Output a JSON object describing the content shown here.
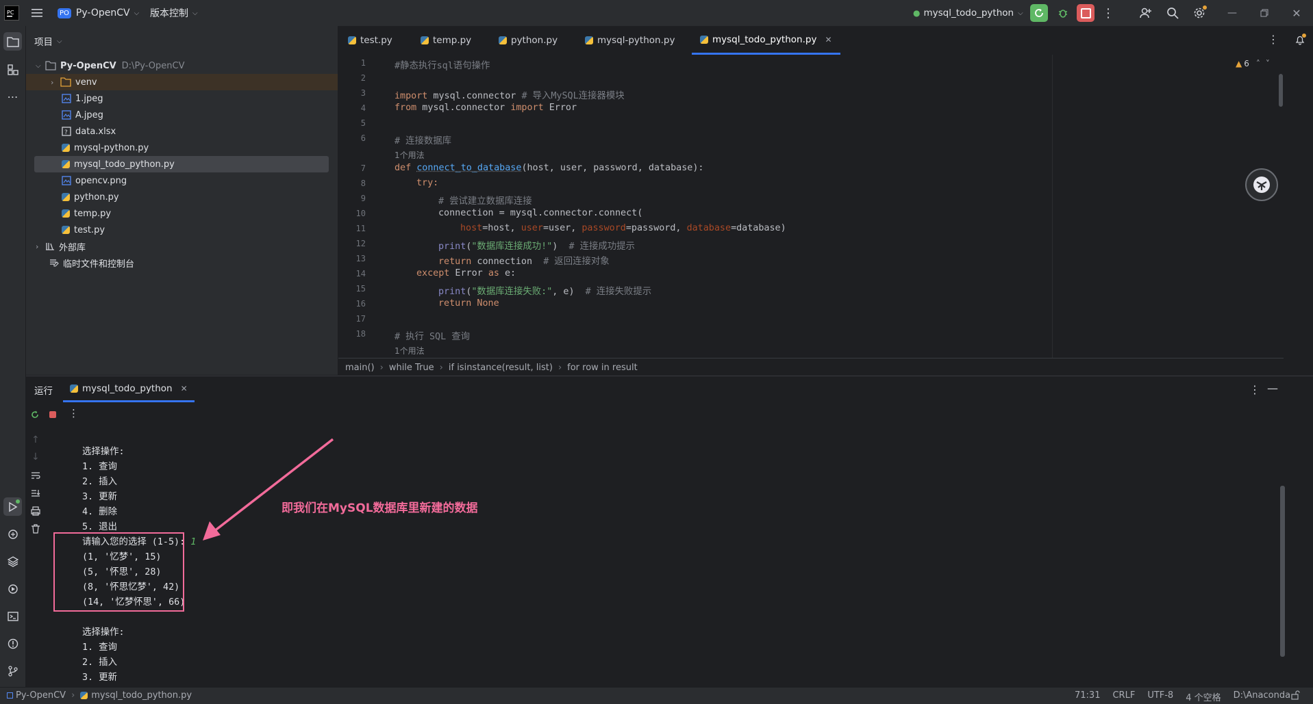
{
  "titlebar": {
    "project_badge": "PO",
    "project_name": "Py-OpenCV",
    "vcs_label": "版本控制",
    "run_config": "mysql_todo_python"
  },
  "project_panel": {
    "header": "项目",
    "root_name": "Py-OpenCV",
    "root_path": "D:\\Py-OpenCV",
    "items": [
      {
        "label": "venv"
      },
      {
        "label": "1.jpeg"
      },
      {
        "label": "A.jpeg"
      },
      {
        "label": "data.xlsx"
      },
      {
        "label": "mysql-python.py"
      },
      {
        "label": "mysql_todo_python.py"
      },
      {
        "label": "opencv.png"
      },
      {
        "label": "python.py"
      },
      {
        "label": "temp.py"
      },
      {
        "label": "test.py"
      },
      {
        "label": "外部库"
      },
      {
        "label": "临时文件和控制台"
      }
    ]
  },
  "tabs": [
    {
      "label": "test.py"
    },
    {
      "label": "temp.py"
    },
    {
      "label": "python.py"
    },
    {
      "label": "mysql-python.py"
    },
    {
      "label": "mysql_todo_python.py"
    }
  ],
  "editor": {
    "warning_count": "6",
    "usage_hint": "1个用法",
    "lines": {
      "l1": "#静态执行sql语句操作",
      "l3a": "import",
      "l3b": " mysql.connector ",
      "l3c": "# 导入MySQL连接器模块",
      "l4a": "from",
      "l4b": " mysql.connector ",
      "l4c": "import",
      "l4d": " Error",
      "l6": "# 连接数据库",
      "l7a": "def",
      "l7b": "connect_to_database",
      "l7c": "(host, user, password, database):",
      "l8": "try:",
      "l9": "# 尝试建立数据库连接",
      "l10": "connection = mysql.connector.connect(",
      "l11a": "host",
      "l11b": "=host, ",
      "l11c": "user",
      "l11d": "=user, ",
      "l11e": "password",
      "l11f": "=password, ",
      "l11g": "database",
      "l11h": "=database)",
      "l12a": "print",
      "l12b": "(",
      "l12c": "\"数据库连接成功!\"",
      "l12d": ")  ",
      "l12e": "# 连接成功提示",
      "l13a": "return",
      "l13b": " connection  ",
      "l13c": "# 返回连接对象",
      "l14a": "except",
      "l14b": " Error ",
      "l14c": "as",
      "l14d": " e:",
      "l15a": "print",
      "l15b": "(",
      "l15c": "\"数据库连接失败:\"",
      "l15d": ", e)  ",
      "l15e": "# 连接失败提示",
      "l16a": "return",
      "l16b": " None",
      "l18": "# 执行 SQL 查询"
    }
  },
  "breadcrumb": [
    "main()",
    "while True",
    "if isinstance(result, list)",
    "for row in result"
  ],
  "run_panel": {
    "title": "运行",
    "tab_label": "mysql_todo_python",
    "output": [
      "选择操作:",
      "1. 查询",
      "2. 插入",
      "3. 更新",
      "4. 删除",
      "5. 退出",
      "请输入您的选择 (1-5): ",
      "(1, '忆梦', 15)",
      "(5, '怀思', 28)",
      "(8, '怀思忆梦', 42)",
      "(14, '忆梦怀思', 66)",
      "",
      "选择操作:",
      "1. 查询",
      "2. 插入",
      "3. 更新"
    ],
    "user_input": "1",
    "annotation": "即我们在MySQL数据库里新建的数据"
  },
  "statusbar": {
    "project": "Py-OpenCV",
    "file": "mysql_todo_python.py",
    "position": "71:31",
    "line_sep": "CRLF",
    "encoding": "UTF-8",
    "indent": "4 个空格",
    "interpreter": "D:\\Anaconda"
  },
  "colors": {
    "accent": "#3574f0",
    "annotation": "#f26b9a",
    "run_green": "#5fb865",
    "stop_red": "#db5c5c"
  }
}
